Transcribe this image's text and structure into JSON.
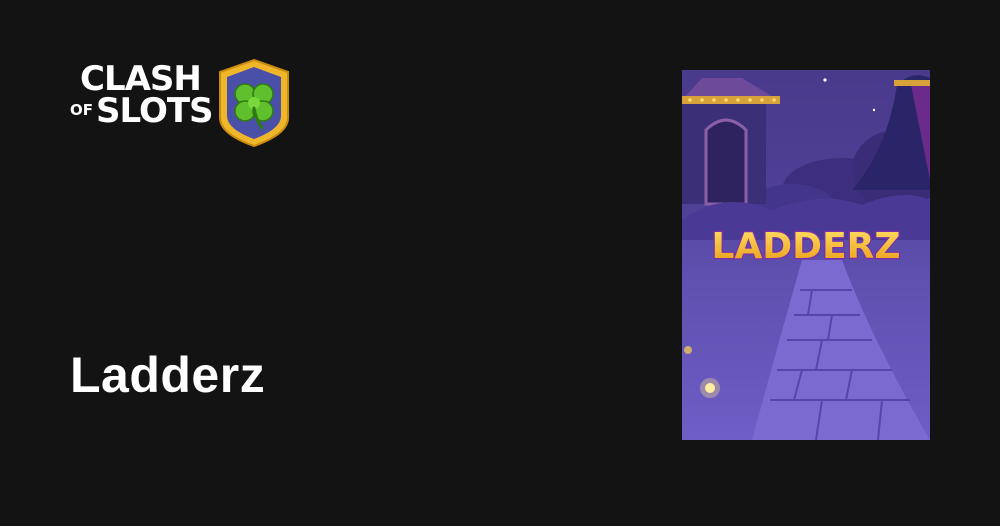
{
  "brand": {
    "line1": "CLASH",
    "line2_small": "OF",
    "line2": "SLOTS",
    "badge_icon": "four-leaf-clover-icon",
    "colors": {
      "badge_border": "#f0b62a",
      "badge_fill": "#4a4fa8",
      "clover": "#5fbf2c"
    }
  },
  "game": {
    "title": "Ladderz",
    "artwork_logo": "LADDERZ",
    "artwork_colors": {
      "sky": "#4b3a8f",
      "path": "#6b5bc2",
      "logo": "#f2c21f"
    }
  },
  "page": {
    "background": "#131313"
  }
}
